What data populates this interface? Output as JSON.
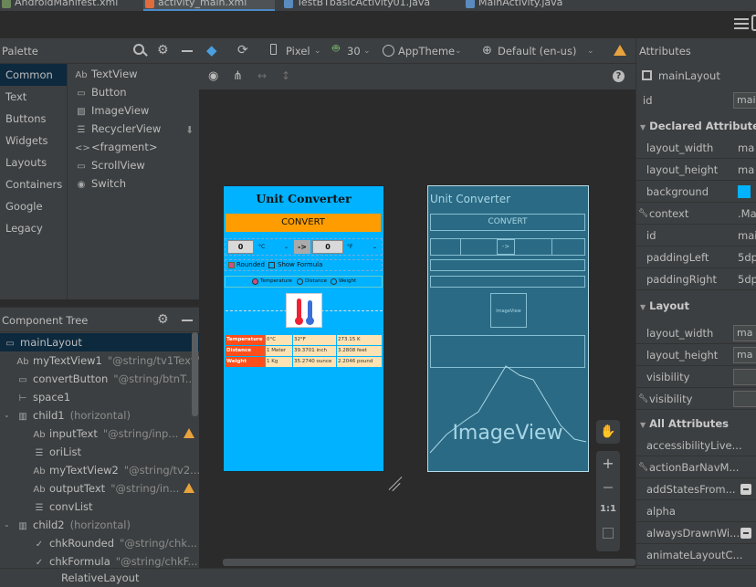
{
  "tabs": [
    {
      "label": "AndroidManifest.xml",
      "color": "#6a8759"
    },
    {
      "label": "activity_main.xml",
      "color": "#e06c3d"
    },
    {
      "label": "TestBTbasicActivity01.java",
      "color": "#5a8bbf"
    },
    {
      "label": "MainActivity.java",
      "color": "#5a8bbf"
    }
  ],
  "toolbar": {
    "device": "Pixel",
    "api": "30",
    "theme": "AppTheme",
    "locale": "Default (en-us)"
  },
  "palette": {
    "title": "Palette",
    "categories": [
      "Common",
      "Text",
      "Buttons",
      "Widgets",
      "Layouts",
      "Containers",
      "Google",
      "Legacy"
    ],
    "widgets": [
      {
        "icon": "Ab",
        "label": "TextView"
      },
      {
        "icon": "▭",
        "label": "Button"
      },
      {
        "icon": "▨",
        "label": "ImageView"
      },
      {
        "icon": "☰",
        "label": "RecyclerView"
      },
      {
        "icon": "<>",
        "label": "<fragment>"
      },
      {
        "icon": "▭",
        "label": "ScrollView"
      },
      {
        "icon": "◉",
        "label": "Switch"
      }
    ]
  },
  "tree": {
    "title": "Component Tree",
    "rows": [
      {
        "icon": "▭",
        "name": "mainLayout",
        "ref": "",
        "indent": 0,
        "warn": false,
        "sel": true
      },
      {
        "icon": "Ab",
        "name": "myTextView1",
        "ref": "\"@string/tv1Text\"",
        "indent": 1,
        "warn": false
      },
      {
        "icon": "▭",
        "name": "convertButton",
        "ref": "\"@string/btnT...",
        "indent": 1,
        "warn": false
      },
      {
        "icon": "⊢",
        "name": "space1",
        "ref": "",
        "indent": 1,
        "warn": false
      },
      {
        "icon": "▥",
        "name": "child1",
        "ref": "(horizontal)",
        "indent": 0,
        "warn": false,
        "exp": true
      },
      {
        "icon": "Ab",
        "name": "inputText",
        "ref": "\"@string/inp...",
        "indent": 2,
        "warn": true
      },
      {
        "icon": "☰",
        "name": "oriList",
        "ref": "",
        "indent": 2,
        "warn": false
      },
      {
        "icon": "Ab",
        "name": "myTextView2",
        "ref": "\"@string/tv2...",
        "indent": 2,
        "warn": false
      },
      {
        "icon": "Ab",
        "name": "outputText",
        "ref": "\"@string/in...",
        "indent": 2,
        "warn": true
      },
      {
        "icon": "☰",
        "name": "convList",
        "ref": "",
        "indent": 2,
        "warn": false
      },
      {
        "icon": "▥",
        "name": "child2",
        "ref": "(horizontal)",
        "indent": 0,
        "warn": false,
        "exp": true
      },
      {
        "icon": "✓",
        "name": "chkRounded",
        "ref": "\"@string/chk...",
        "indent": 2,
        "warn": false
      },
      {
        "icon": "✓",
        "name": "chkFormula",
        "ref": "\"@string/chkF...",
        "indent": 2,
        "warn": false
      }
    ]
  },
  "status": {
    "layout": "RelativeLayout"
  },
  "attributes": {
    "title": "Attributes",
    "component": "mainLayout",
    "id_label": "id",
    "id_value": "mai",
    "declared_title": "Declared Attributes",
    "declared": [
      {
        "label": "layout_width",
        "value": "ma"
      },
      {
        "label": "layout_height",
        "value": "ma"
      },
      {
        "label": "background",
        "value": ""
      },
      {
        "label": "context",
        "value": ".Ma"
      },
      {
        "label": "id",
        "value": "mai"
      },
      {
        "label": "paddingLeft",
        "value": "5dp"
      },
      {
        "label": "paddingRight",
        "value": "5dp"
      }
    ],
    "layout_title": "Layout",
    "layout": [
      {
        "label": "layout_width",
        "value": "ma"
      },
      {
        "label": "layout_height",
        "value": "ma"
      },
      {
        "label": "visibility",
        "value": ""
      },
      {
        "label": "visibility",
        "value": ""
      }
    ],
    "all_title": "All Attributes",
    "all": [
      "accessibilityLive...",
      "actionBarNavM...",
      "addStatesFrom...",
      "alpha",
      "alwaysDrawnWi...",
      "animateLayoutC..."
    ]
  },
  "app": {
    "title": "Unit Converter",
    "convert": "CONVERT",
    "input_value": "0",
    "from_unit": "°C",
    "arrow": "->",
    "output_value": "0",
    "to_unit": "°F",
    "chk_rounded": "Rounded",
    "chk_formula": "Show Formula",
    "radios": [
      "Temperature",
      "Distance",
      "Weight"
    ],
    "table": [
      [
        "Temperature",
        "0°C",
        "32°F",
        "273.15 K"
      ],
      [
        "Distance",
        "1 Meter",
        "39.3701 inch",
        "3.2808 feet"
      ],
      [
        "Weight",
        "1 Kg",
        "35.2740 ounce",
        "2.2046 pound"
      ]
    ]
  },
  "blueprint": {
    "title": "Unit Converter",
    "convert": "CONVERT",
    "imageview": "ImageView",
    "small_imageview": "ImageView"
  },
  "zoom": {
    "ratio": "1:1"
  }
}
